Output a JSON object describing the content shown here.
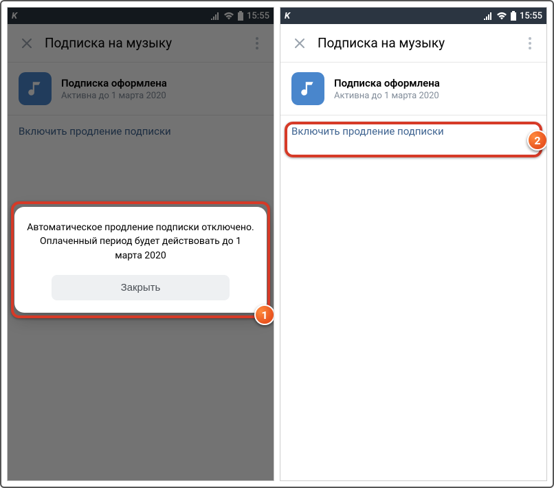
{
  "statusbar": {
    "carrier_glyph": "K",
    "time": "15:55"
  },
  "appbar": {
    "title": "Подписка на музыку"
  },
  "subscription": {
    "title": "Подписка оформлена",
    "subtitle": "Активна до 1 марта 2020"
  },
  "link": {
    "label": "Включить продление подписки"
  },
  "dialog": {
    "message": "Автоматическое продление подписки отключено. Оплаченный период будет действовать до 1 марта 2020",
    "close_label": "Закрыть"
  },
  "annotations": {
    "badge1": "1",
    "badge2": "2"
  }
}
